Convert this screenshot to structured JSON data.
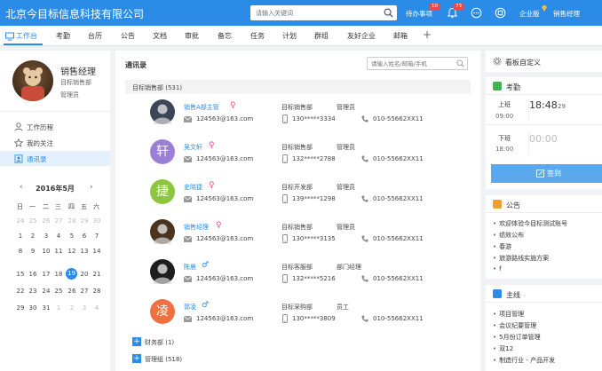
{
  "app": {
    "company_name": "北京今目标信息科技有限公司",
    "search_placeholder": "请输入关键词",
    "todo_label": "待办事项",
    "todo_count": "10",
    "notify_count": "73",
    "enterprise_label": "企业版",
    "user_name": "销售经理"
  },
  "tabs": [
    "工作台",
    "考勤",
    "台历",
    "公告",
    "文档",
    "审批",
    "备忘",
    "任务",
    "计划",
    "群组",
    "友好企业",
    "邮箱"
  ],
  "profile": {
    "name": "销售经理",
    "dept": "目标销售部",
    "role": "管理员"
  },
  "menu": [
    "工作历程",
    "我的关注",
    "通讯录"
  ],
  "calendar": {
    "title": "2016年5月",
    "weekdays": [
      "日",
      "一",
      "二",
      "三",
      "四",
      "五",
      "六"
    ],
    "rows": [
      [
        "24",
        "25",
        "26",
        "27",
        "28",
        "29",
        "30"
      ],
      [
        "1",
        "2",
        "3",
        "4",
        "5",
        "6",
        "7"
      ],
      [
        "8",
        "9",
        "10",
        "11",
        "12",
        "13",
        "14"
      ],
      [
        "15",
        "16",
        "17",
        "18",
        "19",
        "20",
        "21"
      ],
      [
        "22",
        "23",
        "24",
        "25",
        "26",
        "27",
        "28"
      ],
      [
        "29",
        "30",
        "31",
        "1",
        "2",
        "3",
        "4"
      ]
    ],
    "today": "19"
  },
  "contacts": {
    "title": "通讯录",
    "search_placeholder": "请输入姓名/邮箱/手机",
    "group_open": "目标销售部 (531)",
    "people": [
      {
        "name": "销售A部主管",
        "gender": "female",
        "avatar_char": "",
        "avatar_color": "#3c4656",
        "dept": "目标销售部",
        "role": "管理员",
        "mail": "124563@163.com",
        "mobile": "130*****3334",
        "tel": "010-55662XX11"
      },
      {
        "name": "吴文轩",
        "gender": "female",
        "avatar_char": "轩",
        "avatar_color": "#9b7fd4",
        "dept": "目标销售部",
        "role": "管理员",
        "mail": "124563@163.com",
        "mobile": "132*****2788",
        "tel": "010-55662XX11"
      },
      {
        "name": "史晓捷",
        "gender": "female",
        "avatar_char": "捷",
        "avatar_color": "#8cc63e",
        "dept": "目标开发部",
        "role": "管理员",
        "mail": "124563@163.com",
        "mobile": "139*****1298",
        "tel": "010-55662XX11"
      },
      {
        "name": "销售经理",
        "gender": "female",
        "avatar_char": "",
        "avatar_color": "#4a3320",
        "dept": "目标销售部",
        "role": "管理员",
        "mail": "124563@163.com",
        "mobile": "130*****3135",
        "tel": "010-55662XX11"
      },
      {
        "name": "陈晨",
        "gender": "male",
        "avatar_char": "",
        "avatar_color": "#1e1e1e",
        "dept": "目标客服部",
        "role": "部门经理",
        "mail": "124563@163.com",
        "mobile": "132*****5216",
        "tel": "010-55662XX11"
      },
      {
        "name": "郭凌",
        "gender": "male",
        "avatar_char": "凌",
        "avatar_color": "#f07040",
        "dept": "目标采购部",
        "role": "员工",
        "mail": "124563@163.com",
        "mobile": "130*****3809",
        "tel": "010-55662XX11"
      }
    ],
    "groups_collapsed": [
      "财务部 (1)",
      "管理组 (518)"
    ]
  },
  "dashboard": {
    "title": "看板自定义",
    "attendance": {
      "title": "考勤",
      "on_label": "上班",
      "on_time": "09:00",
      "on_clock": "18:48",
      "on_sec": "29",
      "off_label": "下班",
      "off_time": "18:00",
      "off_clock": "00:00",
      "sign_button": "签到"
    },
    "notice": {
      "title": "公告",
      "items": [
        "欢迎体验今目标测试账号",
        "绩效公布",
        "春游",
        "旅游路线实施方案",
        "f"
      ]
    },
    "mainline": {
      "title": "主线",
      "items": [
        "项目管理",
        "会议纪要管理",
        "5月份订单管理",
        "双12",
        "制造行业 - 产品开发"
      ]
    }
  },
  "colors": {
    "brand": "#2a8ce6",
    "attendance_icon": "#3fb34f",
    "notice_icon": "#f0a030",
    "mainline_icon": "#2a8ce6",
    "female": "#e8508a",
    "male": "#2a8ce6"
  }
}
